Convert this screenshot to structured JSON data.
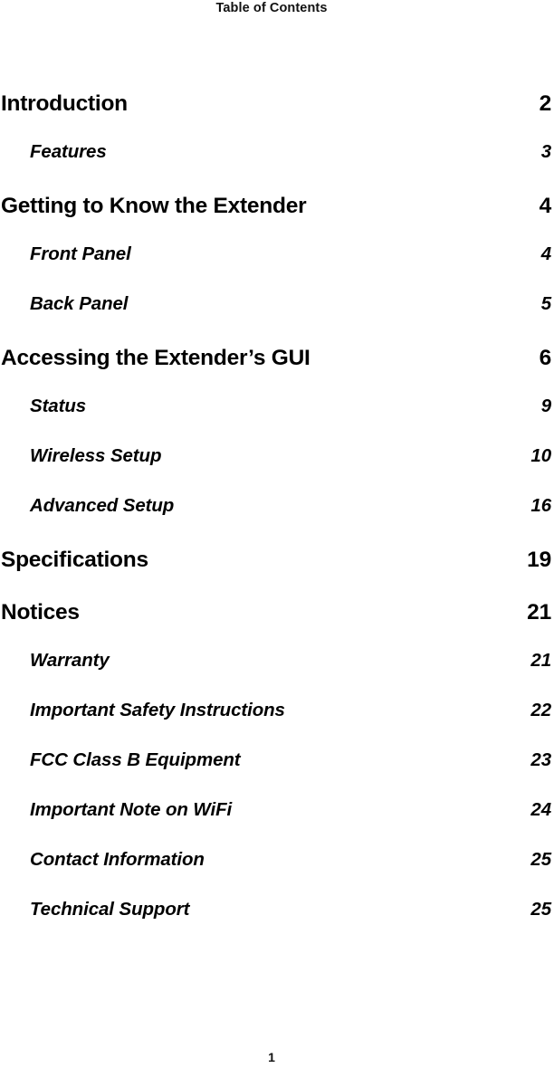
{
  "document": {
    "running_header": "Table of Contents",
    "footer_page_number": "1",
    "text_color": "#000000",
    "background_color": "#ffffff"
  },
  "toc": {
    "entries": [
      {
        "level": 1,
        "title": "Introduction",
        "page": "2"
      },
      {
        "level": 2,
        "title": "Features",
        "page": "3"
      },
      {
        "level": 1,
        "title": "Getting to Know the Extender",
        "page": "4"
      },
      {
        "level": 2,
        "title": "Front Panel",
        "page": "4"
      },
      {
        "level": 2,
        "title": "Back Panel",
        "page": "5"
      },
      {
        "level": 1,
        "title": "Accessing the Extender’s GUI",
        "page": "6"
      },
      {
        "level": 2,
        "title": "Status",
        "page": "9"
      },
      {
        "level": 2,
        "title": "Wireless Setup",
        "page": "10"
      },
      {
        "level": 2,
        "title": "Advanced Setup",
        "page": "16"
      },
      {
        "level": 1,
        "title": "Speciﬁcations",
        "page": "19"
      },
      {
        "level": 1,
        "title": "Notices",
        "page": "21"
      },
      {
        "level": 2,
        "title": "Warranty",
        "page": "21"
      },
      {
        "level": 2,
        "title": "Important Safety Instructions",
        "page": "22"
      },
      {
        "level": 2,
        "title": "FCC Class B Equipment",
        "page": "23"
      },
      {
        "level": 2,
        "title": "Important Note on WiFi",
        "page": "24"
      },
      {
        "level": 2,
        "title": "Contact Information",
        "page": "25"
      },
      {
        "level": 2,
        "title": "Technical Support",
        "page": "25"
      }
    ]
  }
}
